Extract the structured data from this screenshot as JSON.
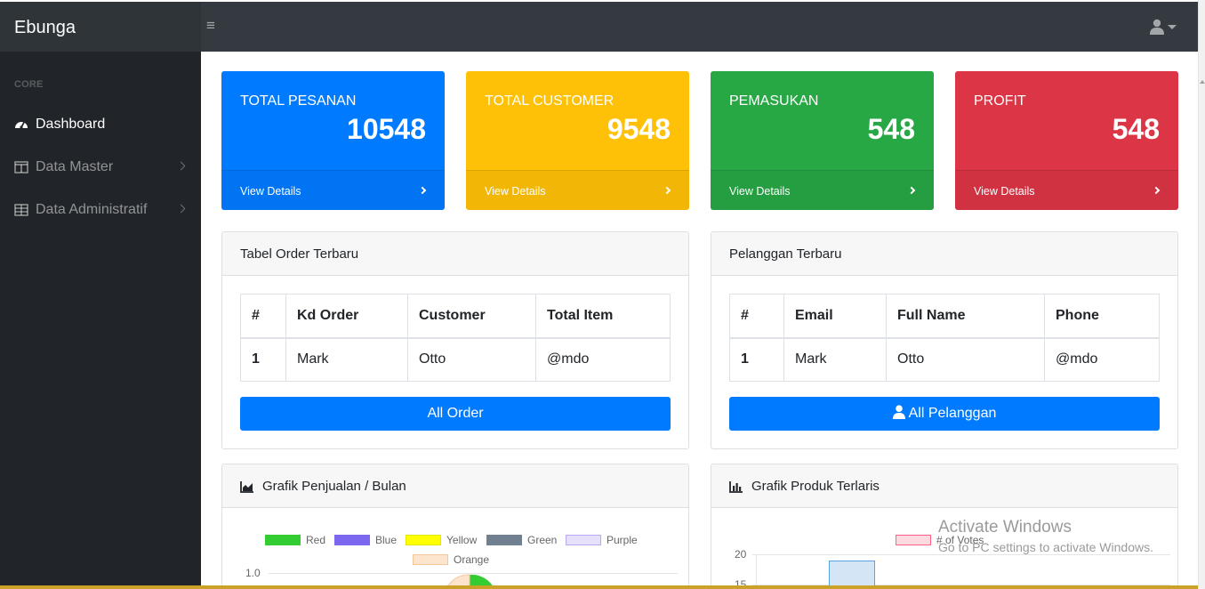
{
  "brand": "Ebunga",
  "sidebar": {
    "heading": "CORE",
    "items": [
      {
        "label": "Dashboard",
        "icon": "tachometer-icon"
      },
      {
        "label": "Data Master",
        "icon": "columns-icon"
      },
      {
        "label": "Data Administratif",
        "icon": "table-icon"
      }
    ]
  },
  "cards": [
    {
      "title": "TOTAL PESANAN",
      "value": "10548",
      "link": "View Details",
      "color": "#007bff"
    },
    {
      "title": "TOTAL CUSTOMER",
      "value": "9548",
      "link": "View Details",
      "color": "#ffc107"
    },
    {
      "title": "PEMASUKAN",
      "value": "548",
      "link": "View Details",
      "color": "#28a745"
    },
    {
      "title": "PROFIT",
      "value": "548",
      "link": "View Details",
      "color": "#dc3545"
    }
  ],
  "orders": {
    "title": "Tabel Order Terbaru",
    "headers": [
      "#",
      "Kd Order",
      "Customer",
      "Total Item"
    ],
    "rows": [
      [
        "1",
        "Mark",
        "Otto",
        "@mdo"
      ]
    ],
    "button": "All Order"
  },
  "customers": {
    "title": "Pelanggan Terbaru",
    "headers": [
      "#",
      "Email",
      "Full Name",
      "Phone"
    ],
    "rows": [
      [
        "1",
        "Mark",
        "Otto",
        "@mdo"
      ]
    ],
    "button": "All Pelanggan"
  },
  "sales_chart": {
    "title": "Grafik Penjualan / Bulan",
    "legend": [
      {
        "label": "Red",
        "color": "#33cc33"
      },
      {
        "label": "Blue",
        "color": "#7b68ee"
      },
      {
        "label": "Yellow",
        "color": "#ffff00"
      },
      {
        "label": "Green",
        "color": "#708090"
      },
      {
        "label": "Purple",
        "color": "#e6e0fa"
      },
      {
        "label": "Orange",
        "color": "#fde4cc"
      }
    ],
    "y_tick": "1.0"
  },
  "product_chart": {
    "title": "Grafik Produk Terlaris",
    "legend": "# of Votes",
    "y_ticks": [
      "20",
      "15"
    ]
  },
  "watermark": {
    "line1": "Activate Windows",
    "line2": "Go to PC settings to activate Windows."
  }
}
